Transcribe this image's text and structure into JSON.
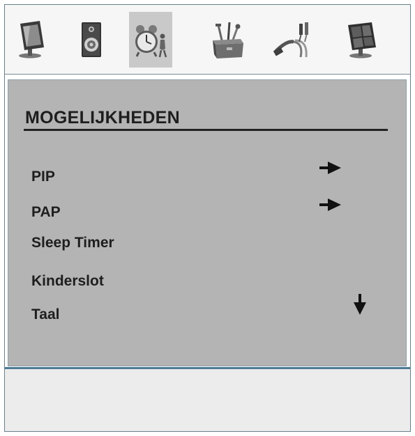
{
  "icon_bar": {
    "tabs": [
      {
        "icon": "picture-icon",
        "selected": false
      },
      {
        "icon": "speaker-icon",
        "selected": false
      },
      {
        "icon": "alarm-clock-icon",
        "selected": true
      },
      {
        "icon": "toolbox-icon",
        "selected": false
      },
      {
        "icon": "cables-icon",
        "selected": false
      },
      {
        "icon": "monitor-icon",
        "selected": false
      }
    ]
  },
  "panel": {
    "title": "MOGELIJKHEDEN",
    "items": [
      {
        "label": "PIP",
        "has_submenu": true
      },
      {
        "label": "PAP",
        "has_submenu": true
      },
      {
        "label": "Sleep Timer",
        "has_submenu": false
      },
      {
        "label": "Kinderslot",
        "has_submenu": false
      },
      {
        "label": "Taal",
        "has_submenu": false
      }
    ],
    "scroll_indicator": "down-arrow-icon"
  },
  "colors": {
    "panel_bg": "#b4b4b4",
    "text": "#1e1e1e",
    "selected_tab_bg": "#c9c9c9",
    "divider": "#4d7b95"
  }
}
